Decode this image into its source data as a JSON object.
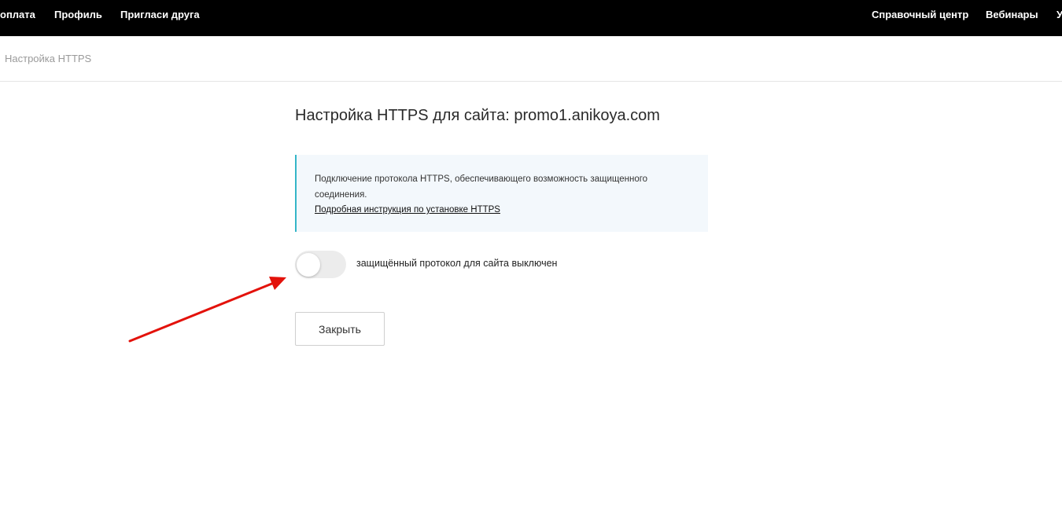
{
  "topnav": {
    "left_items": [
      "оплата",
      "Профиль",
      "Пригласи друга"
    ],
    "right_items": [
      "Справочный центр",
      "Вебинары",
      "У"
    ]
  },
  "breadcrumb": "Настройка HTTPS",
  "page": {
    "title": "Настройка HTTPS для сайта: promo1.anikoya.com",
    "info": {
      "text": "Подключение протокола HTTPS, обеспечивающего возможность защищенного соединения.",
      "link_label": "Подробная инструкция по установке HTTPS"
    },
    "https_toggle": {
      "enabled": false,
      "label": "защищённый протокол для сайта выключен"
    },
    "close_button_label": "Закрыть"
  },
  "colors": {
    "topbar_bg": "#000000",
    "info_accent": "#35b6c8",
    "info_bg": "#f3f8fc",
    "annotation_arrow": "#e3120b"
  }
}
